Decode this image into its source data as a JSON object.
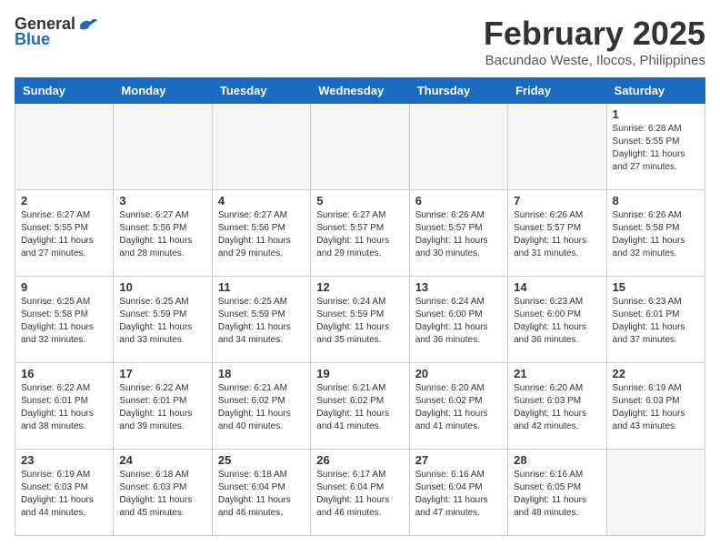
{
  "header": {
    "logo_general": "General",
    "logo_blue": "Blue",
    "month_year": "February 2025",
    "location": "Bacundao Weste, Ilocos, Philippines"
  },
  "calendar": {
    "days_of_week": [
      "Sunday",
      "Monday",
      "Tuesday",
      "Wednesday",
      "Thursday",
      "Friday",
      "Saturday"
    ],
    "weeks": [
      [
        {
          "day": "",
          "info": ""
        },
        {
          "day": "",
          "info": ""
        },
        {
          "day": "",
          "info": ""
        },
        {
          "day": "",
          "info": ""
        },
        {
          "day": "",
          "info": ""
        },
        {
          "day": "",
          "info": ""
        },
        {
          "day": "1",
          "info": "Sunrise: 6:28 AM\nSunset: 5:55 PM\nDaylight: 11 hours and 27 minutes."
        }
      ],
      [
        {
          "day": "2",
          "info": "Sunrise: 6:27 AM\nSunset: 5:55 PM\nDaylight: 11 hours and 27 minutes."
        },
        {
          "day": "3",
          "info": "Sunrise: 6:27 AM\nSunset: 5:56 PM\nDaylight: 11 hours and 28 minutes."
        },
        {
          "day": "4",
          "info": "Sunrise: 6:27 AM\nSunset: 5:56 PM\nDaylight: 11 hours and 29 minutes."
        },
        {
          "day": "5",
          "info": "Sunrise: 6:27 AM\nSunset: 5:57 PM\nDaylight: 11 hours and 29 minutes."
        },
        {
          "day": "6",
          "info": "Sunrise: 6:26 AM\nSunset: 5:57 PM\nDaylight: 11 hours and 30 minutes."
        },
        {
          "day": "7",
          "info": "Sunrise: 6:26 AM\nSunset: 5:57 PM\nDaylight: 11 hours and 31 minutes."
        },
        {
          "day": "8",
          "info": "Sunrise: 6:26 AM\nSunset: 5:58 PM\nDaylight: 11 hours and 32 minutes."
        }
      ],
      [
        {
          "day": "9",
          "info": "Sunrise: 6:25 AM\nSunset: 5:58 PM\nDaylight: 11 hours and 32 minutes."
        },
        {
          "day": "10",
          "info": "Sunrise: 6:25 AM\nSunset: 5:59 PM\nDaylight: 11 hours and 33 minutes."
        },
        {
          "day": "11",
          "info": "Sunrise: 6:25 AM\nSunset: 5:59 PM\nDaylight: 11 hours and 34 minutes."
        },
        {
          "day": "12",
          "info": "Sunrise: 6:24 AM\nSunset: 5:59 PM\nDaylight: 11 hours and 35 minutes."
        },
        {
          "day": "13",
          "info": "Sunrise: 6:24 AM\nSunset: 6:00 PM\nDaylight: 11 hours and 36 minutes."
        },
        {
          "day": "14",
          "info": "Sunrise: 6:23 AM\nSunset: 6:00 PM\nDaylight: 11 hours and 36 minutes."
        },
        {
          "day": "15",
          "info": "Sunrise: 6:23 AM\nSunset: 6:01 PM\nDaylight: 11 hours and 37 minutes."
        }
      ],
      [
        {
          "day": "16",
          "info": "Sunrise: 6:22 AM\nSunset: 6:01 PM\nDaylight: 11 hours and 38 minutes."
        },
        {
          "day": "17",
          "info": "Sunrise: 6:22 AM\nSunset: 6:01 PM\nDaylight: 11 hours and 39 minutes."
        },
        {
          "day": "18",
          "info": "Sunrise: 6:21 AM\nSunset: 6:02 PM\nDaylight: 11 hours and 40 minutes."
        },
        {
          "day": "19",
          "info": "Sunrise: 6:21 AM\nSunset: 6:02 PM\nDaylight: 11 hours and 41 minutes."
        },
        {
          "day": "20",
          "info": "Sunrise: 6:20 AM\nSunset: 6:02 PM\nDaylight: 11 hours and 41 minutes."
        },
        {
          "day": "21",
          "info": "Sunrise: 6:20 AM\nSunset: 6:03 PM\nDaylight: 11 hours and 42 minutes."
        },
        {
          "day": "22",
          "info": "Sunrise: 6:19 AM\nSunset: 6:03 PM\nDaylight: 11 hours and 43 minutes."
        }
      ],
      [
        {
          "day": "23",
          "info": "Sunrise: 6:19 AM\nSunset: 6:03 PM\nDaylight: 11 hours and 44 minutes."
        },
        {
          "day": "24",
          "info": "Sunrise: 6:18 AM\nSunset: 6:03 PM\nDaylight: 11 hours and 45 minutes."
        },
        {
          "day": "25",
          "info": "Sunrise: 6:18 AM\nSunset: 6:04 PM\nDaylight: 11 hours and 46 minutes."
        },
        {
          "day": "26",
          "info": "Sunrise: 6:17 AM\nSunset: 6:04 PM\nDaylight: 11 hours and 46 minutes."
        },
        {
          "day": "27",
          "info": "Sunrise: 6:16 AM\nSunset: 6:04 PM\nDaylight: 11 hours and 47 minutes."
        },
        {
          "day": "28",
          "info": "Sunrise: 6:16 AM\nSunset: 6:05 PM\nDaylight: 11 hours and 48 minutes."
        },
        {
          "day": "",
          "info": ""
        }
      ]
    ]
  }
}
